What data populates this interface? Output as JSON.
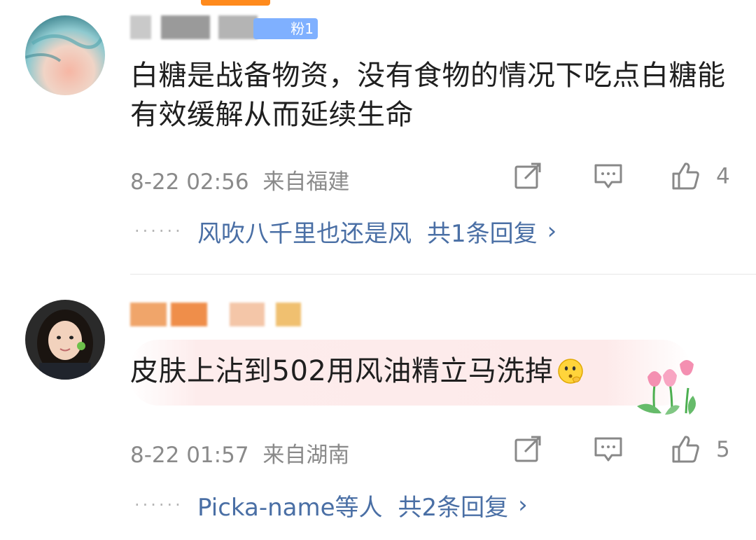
{
  "comments": [
    {
      "fan_badge": "粉1",
      "text": "白糖是战备物资，没有食物的情况下吃点白糖能有效缓解从而延续生命",
      "date": "8-22 02:56",
      "location": "来自福建",
      "likes": "4",
      "reply_preview_name": "风吹八千里也还是风",
      "reply_total": "共1条回复",
      "reply_chevron": "›"
    },
    {
      "text": "皮肤上沾到502用风油精立马洗掉",
      "date": "8-22 01:57",
      "location": "来自湖南",
      "likes": "5",
      "reply_preview_name": "Picka-name等人",
      "reply_total": "共2条回复",
      "reply_chevron": "›"
    }
  ],
  "icons": {
    "share": "share-icon",
    "reply": "comment-icon",
    "like": "thumbs-up-icon",
    "emoji": "thinking-face-emoji",
    "decor": "tulip-sticker"
  },
  "colors": {
    "link": "#4a6fa5",
    "meta": "#8a8a8a",
    "accent": "#ff8a1c",
    "highlight": "#fdecec"
  }
}
